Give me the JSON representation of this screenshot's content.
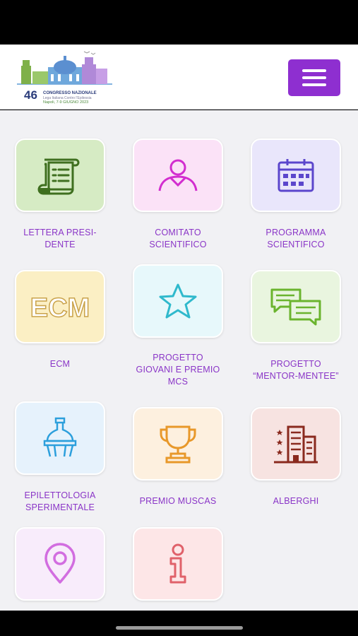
{
  "header": {
    "logo": {
      "number": "46",
      "line1": "CONGRESSO NAZIONALE",
      "line2": "Lega Italiana Contro l'Epilessia",
      "line3": "Napoli, 7-9 GIUGNO 2023"
    },
    "menu_icon": "hamburger-icon",
    "menu_color": "#8e2fd0"
  },
  "tiles": [
    {
      "id": "lettera-presidente",
      "label": "LETTERA PRESI-\nDENTE",
      "icon": "scroll-icon",
      "bg": "#d6ebc4",
      "color": "#3f6f1f"
    },
    {
      "id": "comitato-scientifico",
      "label": "COMITATO\nSCIENTIFICO",
      "icon": "user-icon",
      "bg": "#fbe2f7",
      "color": "#d22dcf"
    },
    {
      "id": "programma-scientifico",
      "label": "PROGRAMMA\nSCIENTIFICO",
      "icon": "calendar-icon",
      "bg": "#e9e6fb",
      "color": "#5b46cc"
    },
    {
      "id": "ecm",
      "label": "ECM",
      "icon": "ecm-text-icon",
      "icon_text": "ECM",
      "bg": "#fbefc4",
      "color": "#c9a24a"
    },
    {
      "id": "progetto-giovani",
      "label": "PROGETTO\nGIOVANI E PREMIO\nMCS",
      "icon": "star-icon",
      "bg": "#e7f8fb",
      "color": "#2fb9cc"
    },
    {
      "id": "mentor-mentee",
      "label": "PROGETTO\n“MENTOR-MENTEE”",
      "icon": "chat-icon",
      "bg": "#e9f5df",
      "color": "#6ab42e"
    },
    {
      "id": "epilettologia",
      "label": "EPILETTOLOGIA\nSPERIMENTALE",
      "icon": "flask-icon",
      "bg": "#e6f2fc",
      "color": "#2c9fdc"
    },
    {
      "id": "premio-muscas",
      "label": "PREMIO MUSCAS",
      "icon": "trophy-icon",
      "bg": "#fdf0df",
      "color": "#e8982a"
    },
    {
      "id": "alberghi",
      "label": "ALBERGHI",
      "icon": "hotel-icon",
      "bg": "#f7e3e1",
      "color": "#8a2a1e"
    },
    {
      "id": "mappa",
      "label": "",
      "icon": "location-pin-icon",
      "bg": "#f8ecfb",
      "color": "#d26de0"
    },
    {
      "id": "info",
      "label": "",
      "icon": "info-icon",
      "bg": "#fde6e7",
      "color": "#e0616a"
    }
  ]
}
